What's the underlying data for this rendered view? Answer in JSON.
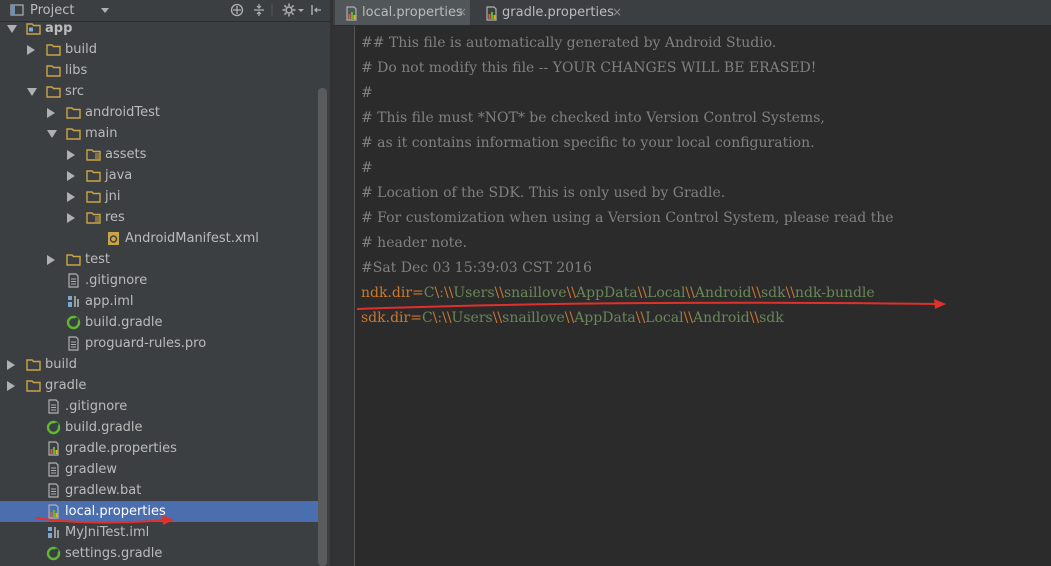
{
  "project_panel": {
    "title": "Project",
    "colors": {
      "background": "#3c3f41",
      "selection": "#4b6eaf",
      "folder": "#c9a449",
      "gradle": "#5fb832"
    },
    "tree": [
      {
        "label": "app",
        "level": 1,
        "icon": "module-folder-icon",
        "state": "expanded",
        "bold": true
      },
      {
        "label": "build",
        "level": 2,
        "icon": "folder-icon",
        "state": "collapsed"
      },
      {
        "label": "libs",
        "level": 2,
        "icon": "folder-icon",
        "state": "none"
      },
      {
        "label": "src",
        "level": 2,
        "icon": "folder-icon",
        "state": "expanded"
      },
      {
        "label": "androidTest",
        "level": 3,
        "icon": "folder-icon",
        "state": "collapsed"
      },
      {
        "label": "main",
        "level": 3,
        "icon": "folder-icon",
        "state": "expanded"
      },
      {
        "label": "assets",
        "level": 4,
        "icon": "resource-folder-icon",
        "state": "collapsed"
      },
      {
        "label": "java",
        "level": 4,
        "icon": "folder-icon",
        "state": "collapsed"
      },
      {
        "label": "jni",
        "level": 4,
        "icon": "folder-icon",
        "state": "collapsed"
      },
      {
        "label": "res",
        "level": 4,
        "icon": "resource-folder-icon",
        "state": "collapsed"
      },
      {
        "label": "AndroidManifest.xml",
        "level": 5,
        "icon": "manifest-file-icon",
        "state": "none"
      },
      {
        "label": "test",
        "level": 3,
        "icon": "folder-icon",
        "state": "collapsed"
      },
      {
        "label": ".gitignore",
        "level": 3,
        "icon": "text-file-icon",
        "state": "none"
      },
      {
        "label": "app.iml",
        "level": 3,
        "icon": "iml-file-icon",
        "state": "none"
      },
      {
        "label": "build.gradle",
        "level": 3,
        "icon": "gradle-file-icon",
        "state": "none"
      },
      {
        "label": "proguard-rules.pro",
        "level": 3,
        "icon": "text-file-icon",
        "state": "none"
      },
      {
        "label": "build",
        "level": 1,
        "icon": "folder-icon",
        "state": "collapsed"
      },
      {
        "label": "gradle",
        "level": 1,
        "icon": "folder-icon",
        "state": "collapsed"
      },
      {
        "label": ".gitignore",
        "level": 2,
        "icon": "text-file-icon",
        "state": "none"
      },
      {
        "label": "build.gradle",
        "level": 2,
        "icon": "gradle-file-icon",
        "state": "none"
      },
      {
        "label": "gradle.properties",
        "level": 2,
        "icon": "properties-file-icon",
        "state": "none"
      },
      {
        "label": "gradlew",
        "level": 2,
        "icon": "text-file-icon",
        "state": "none"
      },
      {
        "label": "gradlew.bat",
        "level": 2,
        "icon": "text-file-icon",
        "state": "none"
      },
      {
        "label": "local.properties",
        "level": 2,
        "icon": "properties-file-icon",
        "state": "none",
        "selected": true
      },
      {
        "label": "MyJniTest.iml",
        "level": 2,
        "icon": "iml-file-icon",
        "state": "none"
      },
      {
        "label": "settings.gradle",
        "level": 2,
        "icon": "gradle-file-icon",
        "state": "none"
      }
    ]
  },
  "tabs": [
    {
      "label": "local.properties",
      "close": "×",
      "active": true,
      "icon": "properties-file-icon"
    },
    {
      "label": "gradle.properties",
      "close": "×",
      "active": false,
      "icon": "properties-file-icon"
    }
  ],
  "editor": {
    "colors": {
      "comment": "#808080",
      "key": "#cc7832",
      "value": "#6a8759",
      "background": "#2b2b2b",
      "annotation_arrow": "#e0302b"
    },
    "lines": [
      {
        "text": "## This file is automatically generated by Android Studio.",
        "kind": "comment"
      },
      {
        "text": "# Do not modify this file -- YOUR CHANGES WILL BE ERASED!",
        "kind": "comment"
      },
      {
        "text": "#",
        "kind": "comment"
      },
      {
        "text": "# This file must *NOT* be checked into Version Control Systems,",
        "kind": "comment"
      },
      {
        "text": "# as it contains information specific to your local configuration.",
        "kind": "comment"
      },
      {
        "text": "#",
        "kind": "comment"
      },
      {
        "text": "# Location of the SDK. This is only used by Gradle.",
        "kind": "comment"
      },
      {
        "text": "# For customization when using a Version Control System, please read the",
        "kind": "comment"
      },
      {
        "text": "# header note.",
        "kind": "comment"
      },
      {
        "text": "#Sat Dec 03 15:39:03 CST 2016",
        "kind": "comment"
      },
      {
        "text": "ndk.dir=C\\:\\\\Users\\\\snaillove\\\\AppData\\\\Local\\\\Android\\\\sdk\\\\ndk-bundle",
        "kind": "property"
      },
      {
        "text": "sdk.dir=C\\:\\\\Users\\\\snaillove\\\\AppData\\\\Local\\\\Android\\\\sdk",
        "kind": "property"
      }
    ]
  }
}
